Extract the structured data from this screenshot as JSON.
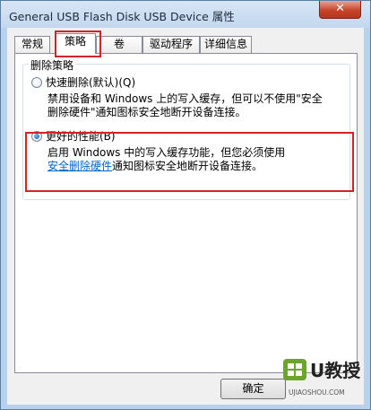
{
  "window": {
    "title": "General USB Flash Disk USB Device 属性",
    "close_label": "✕"
  },
  "tabs": [
    {
      "label": "常规",
      "active": false
    },
    {
      "label": "策略",
      "active": true
    },
    {
      "label": "卷",
      "active": false
    },
    {
      "label": "驱动程序",
      "active": false
    },
    {
      "label": "详细信息",
      "active": false
    }
  ],
  "removal_policy": {
    "group_label": "删除策略",
    "quick_removal": {
      "label": "快速删除(默认)(Q)",
      "selected": false,
      "desc_line1": "禁用设备和 Windows 上的写入缓存，但可以不使用\"安全",
      "desc_line2": "删除硬件\"通知图标安全地断开设备连接。"
    },
    "better_performance": {
      "label": "更好的性能(B)",
      "selected": true,
      "desc_line1": "启用 Windows 中的写入缓存功能，但您必须使用",
      "desc_link": "安全删除硬件",
      "desc_line2_rest": "通知图标安全地断开设备连接。"
    }
  },
  "buttons": {
    "ok_label": "确定"
  },
  "watermark": {
    "brand": "U教授",
    "url": "UJIAOSHOU.COM"
  },
  "colors": {
    "highlight": "#d2232a",
    "link": "#0066cc",
    "watermark_green": "#6ca52c"
  }
}
